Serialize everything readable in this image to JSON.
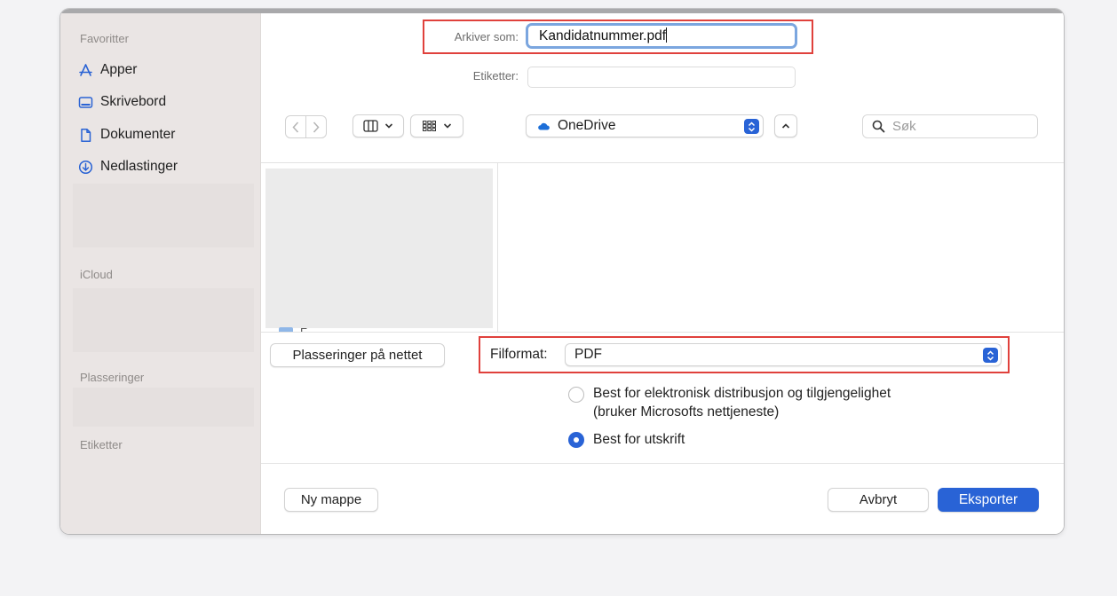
{
  "sidebar": {
    "favorites_header": "Favoritter",
    "items": [
      {
        "label": "Apper",
        "icon": "apps-icon"
      },
      {
        "label": "Skrivebord",
        "icon": "desktop-icon"
      },
      {
        "label": "Dokumenter",
        "icon": "document-icon"
      },
      {
        "label": "Nedlastinger",
        "icon": "download-icon"
      }
    ],
    "icloud_header": "iCloud",
    "locations_header": "Plasseringer",
    "tags_header": "Etiketter"
  },
  "save": {
    "save_as_label": "Arkiver som:",
    "filename": "Kandidatnummer.pdf",
    "tags_label": "Etiketter:",
    "tags_value": ""
  },
  "toolbar": {
    "location": "OneDrive",
    "search_placeholder": "Søk"
  },
  "browser": {
    "partial_item": "F... ... ... ..."
  },
  "options": {
    "online_locations_button": "Plasseringer på nettet",
    "format_label": "Filformat:",
    "format_value": "PDF",
    "radio_electronic_line1": "Best for elektronisk distribusjon og tilgjengelighet",
    "radio_electronic_line2": "(bruker Microsofts nettjeneste)",
    "radio_print": "Best for utskrift",
    "selected": "print"
  },
  "footer": {
    "new_folder": "Ny mappe",
    "cancel": "Avbryt",
    "export": "Eksporter"
  },
  "colors": {
    "accent": "#2963d6",
    "highlight": "#e0413c",
    "focus_ring": "#7ba6df"
  }
}
